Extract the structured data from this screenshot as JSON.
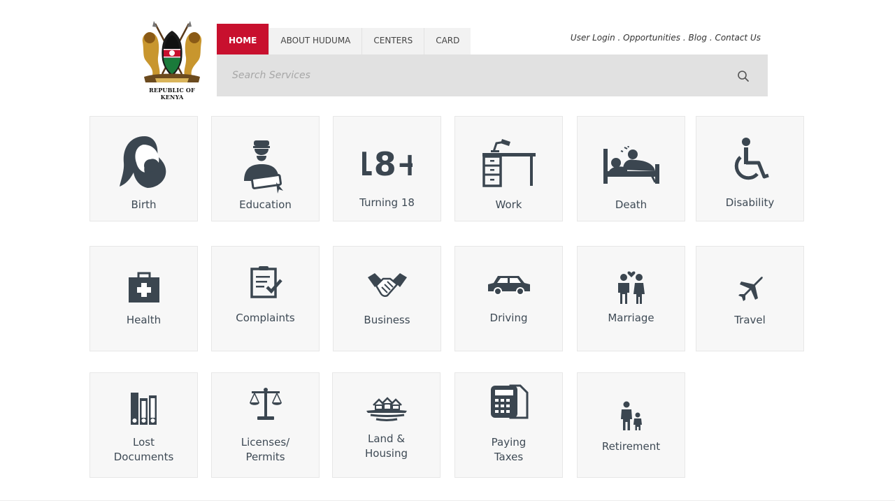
{
  "logo": {
    "text": "REPUBLIC OF KENYA"
  },
  "nav": {
    "tabs": [
      "HOME",
      "ABOUT HUDUMA",
      "CENTERS",
      "CARD"
    ],
    "active": "HOME"
  },
  "top_links": {
    "user_login": "User Login",
    "opportunities": "Opportunities",
    "blog": "Blog",
    "contact_us": "Contact Us",
    "separator": " . "
  },
  "search": {
    "placeholder": "Search Services",
    "value": ""
  },
  "colors": {
    "brand_red": "#c8102e",
    "icon_slate": "#3b4650",
    "tile_bg": "#f7f7f7"
  },
  "services": [
    {
      "label": "Birth",
      "icon": "mother-child-icon"
    },
    {
      "label": "Education",
      "icon": "graduate-icon"
    },
    {
      "label": "Turning 18",
      "icon": "eighteen-plus-icon"
    },
    {
      "label": "Work",
      "icon": "desk-icon"
    },
    {
      "label": "Death",
      "icon": "hospital-bed-icon"
    },
    {
      "label": "Disability",
      "icon": "wheelchair-icon"
    },
    {
      "label": "Health",
      "icon": "medical-kit-icon"
    },
    {
      "label": "Complaints",
      "icon": "clipboard-icon"
    },
    {
      "label": "Business",
      "icon": "handshake-icon"
    },
    {
      "label": "Driving",
      "icon": "car-icon"
    },
    {
      "label": "Marriage",
      "icon": "couple-icon"
    },
    {
      "label": "Travel",
      "icon": "airplane-icon"
    },
    {
      "label": "Lost\nDocuments",
      "icon": "binders-icon"
    },
    {
      "label": "Licenses/\nPermits",
      "icon": "scales-icon"
    },
    {
      "label": "Land &\nHousing",
      "icon": "houses-icon"
    },
    {
      "label": "Paying\nTaxes",
      "icon": "calculator-icon"
    },
    {
      "label": "Retirement",
      "icon": "parent-child-icon"
    }
  ]
}
